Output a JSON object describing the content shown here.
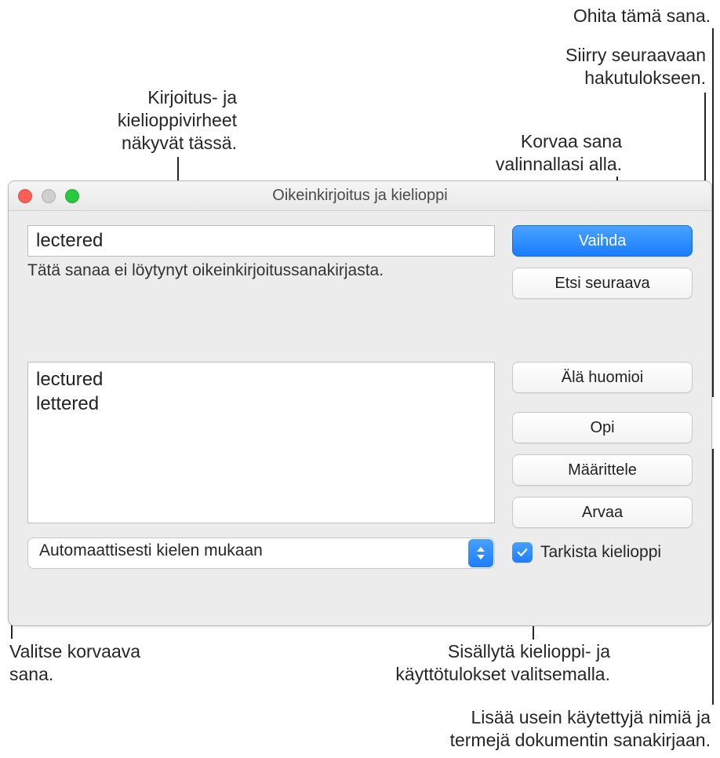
{
  "callouts": {
    "ignore": "Ohita tämä sana.",
    "next": "Siirry seuraavaan\nhakutulokseen.",
    "errors_here": "Kirjoitus- ja\nkielioppivirheet\nnäkyvät tässä.",
    "replace": "Korvaa sana\nvalinnallasi alla.",
    "choose_replacement": "Valitse korvaava\nsana.",
    "include_grammar": "Sisällytä kielioppi- ja\nkäyttötulokset valitsemalla.",
    "add_terms": "Lisää usein käytettyjä nimiä ja\ntermejä dokumentin sanakirjaan."
  },
  "window": {
    "title": "Oikeinkirjoitus ja kielioppi",
    "word": "lectered",
    "not_found_msg": "Tätä sanaa ei löytynyt oikeinkirjoitussanakirjasta.",
    "suggestions": [
      "lectured",
      "lettered"
    ],
    "language_select": "Automaattisesti kielen mukaan",
    "check_grammar_label": "Tarkista kielioppi",
    "check_grammar_checked": true,
    "buttons": {
      "change": "Vaihda",
      "find_next": "Etsi seuraava",
      "ignore": "Älä huomioi",
      "learn": "Opi",
      "define": "Määrittele",
      "guess": "Arvaa"
    }
  }
}
